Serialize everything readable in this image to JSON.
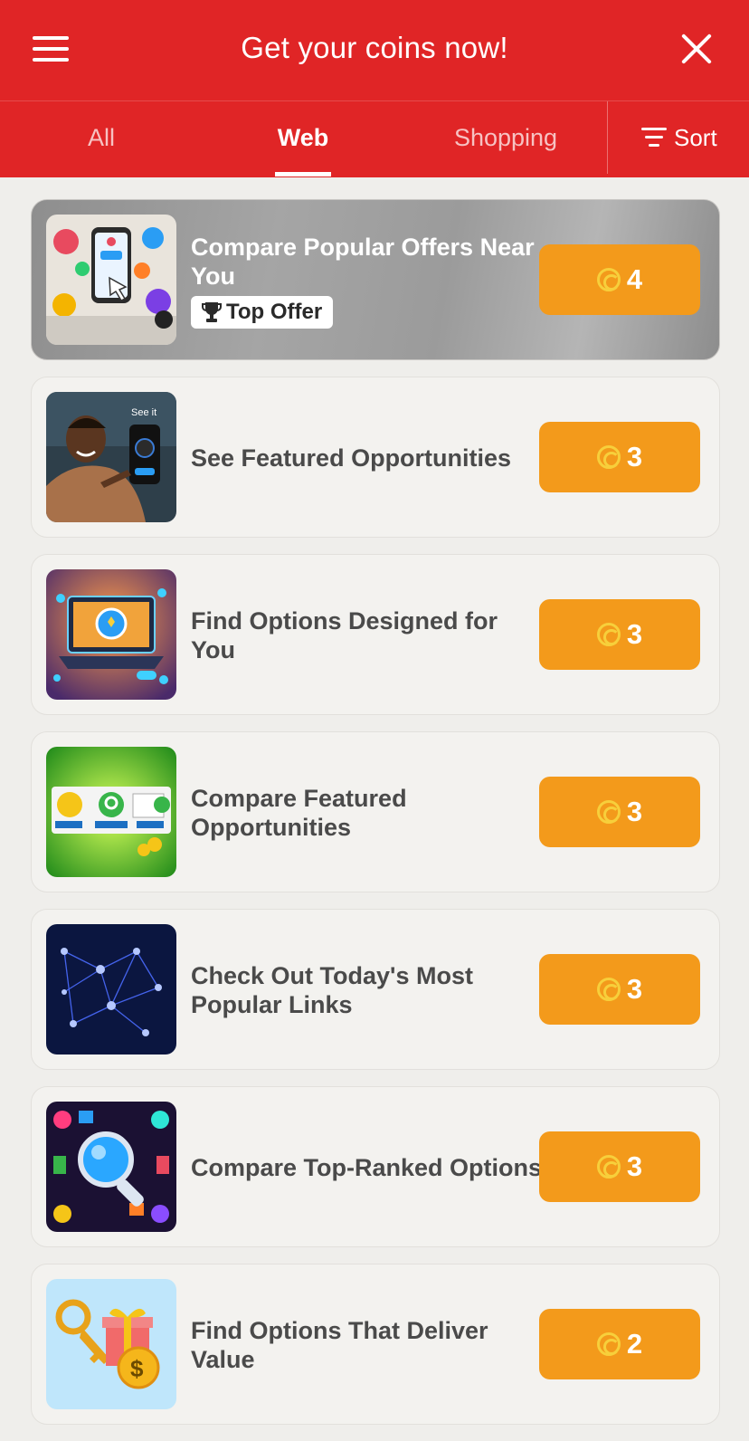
{
  "header": {
    "title": "Get your coins now!"
  },
  "tabs": [
    {
      "label": "All"
    },
    {
      "label": "Web"
    },
    {
      "label": "Shopping"
    }
  ],
  "active_tab": "Web",
  "sort": {
    "label": "Sort"
  },
  "offers": [
    {
      "title": "Compare Popular Offers Near You",
      "badge": "Top Offer",
      "reward": "4",
      "thumb": "phone-collage"
    },
    {
      "title": "See Featured Opportunities",
      "reward": "3",
      "thumb": "man-with-phone"
    },
    {
      "title": "Find Options Designed for You",
      "reward": "3",
      "thumb": "laptop-search"
    },
    {
      "title": "Compare Featured Opportunities",
      "reward": "3",
      "thumb": "tap-search-click"
    },
    {
      "title": "Check Out Today's Most Popular Links",
      "reward": "3",
      "thumb": "network-graph"
    },
    {
      "title": "Compare Top-Ranked Options",
      "reward": "3",
      "thumb": "magnifier-collage"
    },
    {
      "title": "Find Options That Deliver Value",
      "reward": "2",
      "thumb": "key-gift-coin"
    }
  ],
  "colors": {
    "header": "#e02526",
    "reward_button": "#f39a1b",
    "coin": "#f7cf3b",
    "background": "#efeeeb"
  }
}
